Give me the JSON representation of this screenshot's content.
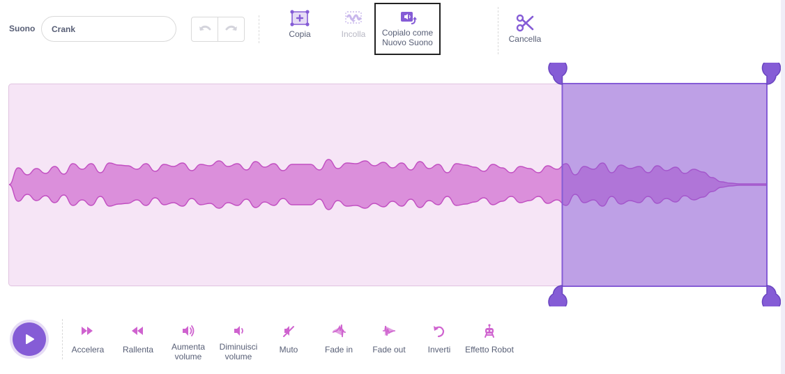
{
  "toolbar": {
    "sound_label": "Suono",
    "sound_name": "Crank",
    "copy_label": "Copia",
    "paste_label": "Incolla",
    "copy_new_line1": "Copialo come",
    "copy_new_line2": "Nuovo Suono",
    "delete_label": "Cancella"
  },
  "editor": {
    "selection": {
      "start": 0.73,
      "end": 1.0
    },
    "colors": {
      "wave_fill": "#cf63cf",
      "wave_bg": "#f6e5f6",
      "selection": "#855cd6",
      "accent": "#855cd6"
    }
  },
  "effects": [
    {
      "line1": "Accelera",
      "line2": "",
      "icon": "fast-forward-icon"
    },
    {
      "line1": "Rallenta",
      "line2": "",
      "icon": "rewind-icon"
    },
    {
      "line1": "Aumenta",
      "line2": "volume",
      "icon": "volume-up-icon"
    },
    {
      "line1": "Diminuisci",
      "line2": "volume",
      "icon": "volume-down-icon"
    },
    {
      "line1": "Muto",
      "line2": "",
      "icon": "mute-icon"
    },
    {
      "line1": "Fade in",
      "line2": "",
      "icon": "fade-in-icon"
    },
    {
      "line1": "Fade out",
      "line2": "",
      "icon": "fade-out-icon"
    },
    {
      "line1": "Inverti",
      "line2": "",
      "icon": "reverse-icon"
    },
    {
      "line1": "Effetto Robot",
      "line2": "",
      "icon": "robot-icon"
    }
  ]
}
